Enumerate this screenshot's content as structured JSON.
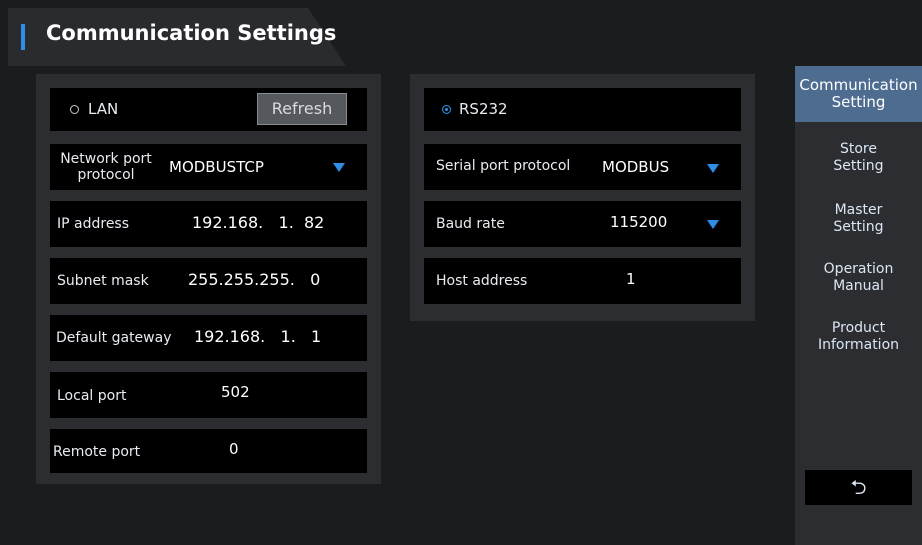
{
  "header": {
    "title": "Communication Settings"
  },
  "lan": {
    "mode_label": "LAN",
    "refresh_label": "Refresh",
    "rows": {
      "network_protocol": {
        "label_line1": "Network port",
        "label_line2": "protocol",
        "value": "MODBUSTCP"
      },
      "ip_address": {
        "label": "IP address",
        "value": "192.168.   1.  82"
      },
      "subnet_mask": {
        "label": "Subnet mask",
        "value": "255.255.255.   0"
      },
      "default_gateway": {
        "label": "Default gateway",
        "value": "192.168.   1.   1"
      },
      "local_port": {
        "label": "Local port",
        "value": "502"
      },
      "remote_port": {
        "label": "Remote port",
        "value": "0"
      }
    }
  },
  "serial": {
    "mode_label": "RS232",
    "rows": {
      "protocol": {
        "label": "Serial port protocol",
        "value": "MODBUS"
      },
      "baud_rate": {
        "label": "Baud rate",
        "value": "115200"
      },
      "host_address": {
        "label": "Host address",
        "value": "1"
      }
    }
  },
  "sidebar": {
    "items": [
      {
        "line1": "Communication",
        "line2": "Setting",
        "active": true
      },
      {
        "line1": "Store",
        "line2": "Setting"
      },
      {
        "line1": "Master",
        "line2": "Setting"
      },
      {
        "line1": "Operation",
        "line2": "Manual"
      },
      {
        "line1": "Product",
        "line2": "Information"
      }
    ],
    "back_icon": "undo-arrow-icon",
    "back_glyph": "⮌"
  },
  "colors": {
    "accent": "#2f8fe6",
    "active_nav": "#4e6c90",
    "panel": "#2c2d30",
    "background": "#1b1c1e"
  }
}
